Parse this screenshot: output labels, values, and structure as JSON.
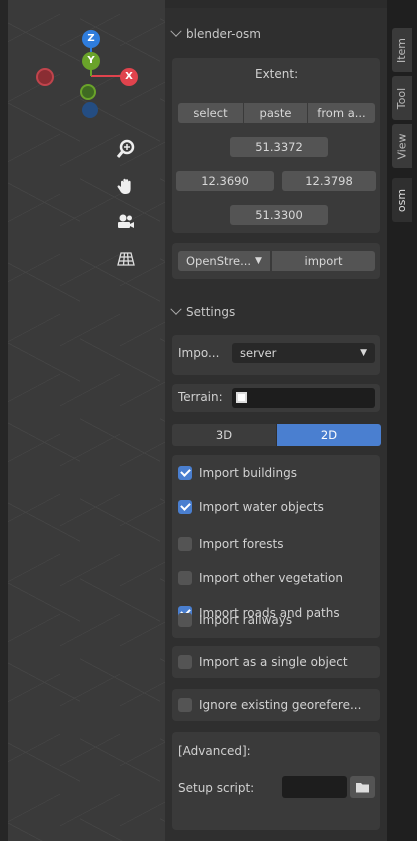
{
  "gizmo": {
    "z": "Z",
    "y": "Y",
    "x": "X"
  },
  "tabs": [
    "Item",
    "Tool",
    "View",
    "osm"
  ],
  "panel": {
    "title": "blender-osm",
    "extent_label": "Extent:",
    "buttons": [
      "select",
      "paste",
      "from a..."
    ],
    "lat_max": "51.3372",
    "lon_min": "12.3690",
    "lon_max": "12.3798",
    "lat_min": "51.3300",
    "source_select": "OpenStre...",
    "import_button": "import"
  },
  "settings": {
    "title": "Settings",
    "import_label": "Impo...",
    "import_value": "server",
    "terrain_label": "Terrain:",
    "mode_3d": "3D",
    "mode_2d": "2D",
    "checks": [
      {
        "label": "Import buildings",
        "checked": true
      },
      {
        "label": "Import water objects",
        "checked": true
      },
      {
        "label": "Import forests",
        "checked": false
      },
      {
        "label": "Import other vegetation",
        "checked": false
      },
      {
        "label": "Import roads and paths",
        "checked": true
      },
      {
        "label": "Import railways",
        "checked": false
      }
    ],
    "single_object": "Import as a single object",
    "ignore_georef": "Ignore existing georefere...",
    "advanced": "[Advanced]:",
    "setup_script": "Setup script:"
  },
  "colors": {
    "accent": "#4a7fd0",
    "x_axis": "#e0434d",
    "y_axis": "#6aa32a",
    "z_axis": "#2f7ddd"
  }
}
